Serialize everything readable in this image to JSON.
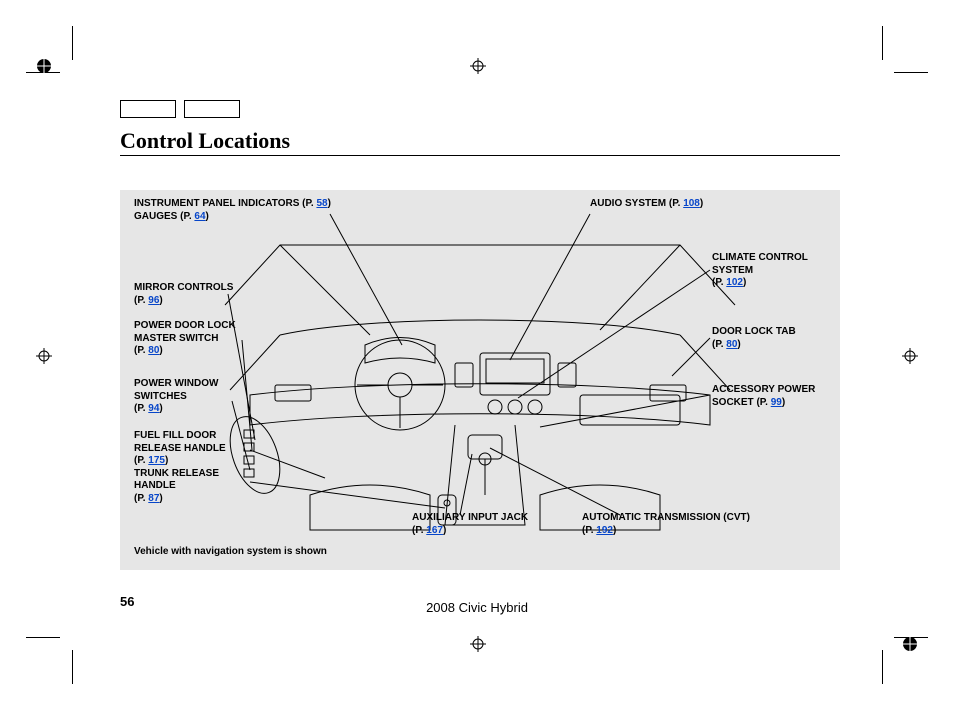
{
  "heading": "Control Locations",
  "page_number": "56",
  "footer": "2008  Civic  Hybrid",
  "note": "Vehicle with navigation system is shown",
  "labels": {
    "ipi": {
      "text": "INSTRUMENT PANEL INDICATORS",
      "page": "58"
    },
    "gauges": {
      "text": "GAUGES",
      "page": "64"
    },
    "audio": {
      "text": "AUDIO SYSTEM",
      "page": "108"
    },
    "climate": {
      "text": "CLIMATE CONTROL SYSTEM",
      "page": "102"
    },
    "mirror": {
      "text": "MIRROR CONTROLS",
      "page": "96"
    },
    "pdl": {
      "text": "POWER DOOR LOCK MASTER SWITCH",
      "page": "80"
    },
    "pws": {
      "text": "POWER WINDOW SWITCHES",
      "page": "94"
    },
    "ffd": {
      "text": "FUEL FILL DOOR RELEASE HANDLE",
      "page": "175"
    },
    "trh": {
      "text": "TRUNK RELEASE HANDLE",
      "page": "87"
    },
    "aux": {
      "text": "AUXILIARY INPUT JACK",
      "page": "167"
    },
    "dlt": {
      "text": "DOOR LOCK TAB",
      "page": "80"
    },
    "aps": {
      "text": "ACCESSORY POWER SOCKET",
      "page": "99"
    },
    "atc": {
      "text": "AUTOMATIC TRANSMISSION (CVT)",
      "page": "192"
    }
  }
}
